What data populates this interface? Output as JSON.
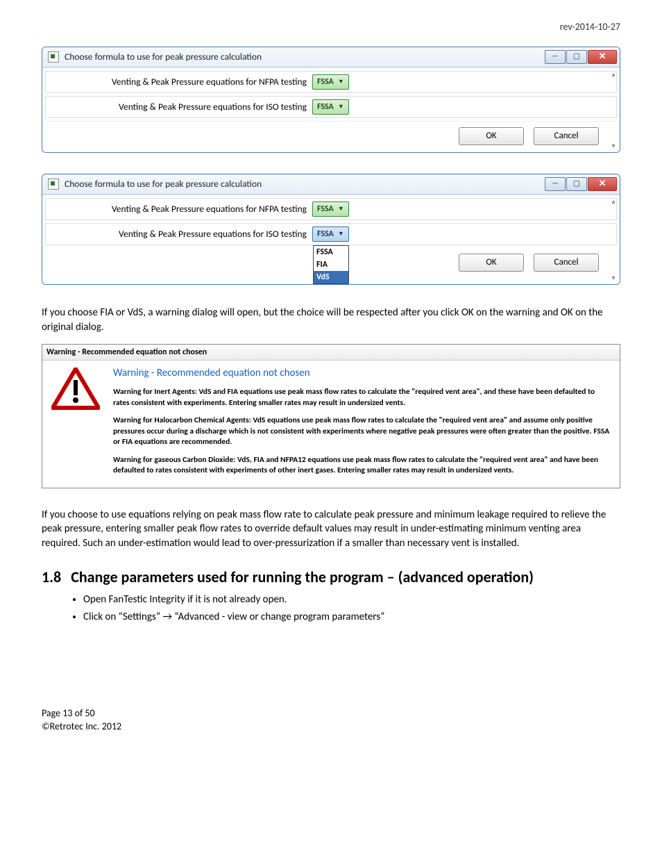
{
  "header": {
    "revision": "rev-2014-10-27"
  },
  "dialog1": {
    "title": "Choose formula to use for peak pressure calculation",
    "row_nfpa_label": "Venting & Peak Pressure equations for NFPA testing",
    "row_nfpa_value": "FSSA",
    "row_iso_label": "Venting & Peak Pressure equations for ISO testing",
    "row_iso_value": "FSSA",
    "ok": "OK",
    "cancel": "Cancel"
  },
  "dialog2": {
    "title": "Choose formula to use for peak pressure calculation",
    "row_nfpa_label": "Venting & Peak Pressure equations for NFPA testing",
    "row_nfpa_value": "FSSA",
    "row_iso_label": "Venting & Peak Pressure equations for ISO testing",
    "row_iso_value": "FSSA",
    "options": {
      "a": "FSSA",
      "b": "FIA",
      "c": "VdS"
    },
    "ok": "OK",
    "cancel": "Cancel"
  },
  "para1": "If you choose FIA or VdS, a warning dialog will open, but the choice will be respected after you click OK on the warning and OK on the original dialog.",
  "warn": {
    "title": "Warning - Recommended equation not chosen",
    "headline": "Warning - Recommended equation not chosen",
    "msg1": "Warning for Inert Agents:  VdS and FIA equations use peak mass flow rates to calculate the \"required vent area\", and these have been defaulted to rates consistent with experiments.  Entering smaller rates may result in undersized vents.",
    "msg2": "Warning for Halocarbon Chemical Agents:  VdS equations use peak mass flow rates to calculate the \"required vent area\" and assume only positive pressures occur during a discharge which is not consistent with experiments where negative peak pressures were often greater than the positive.  FSSA or FIA equations are recommended.",
    "msg3": "Warning for gaseous Carbon Dioxide:  VdS, FIA and NFPA12 equations use peak mass flow rates to calculate the \"required vent area\" and have been defaulted to rates consistent with experiments of other inert gases.  Entering smaller rates may result in undersized vents."
  },
  "para2": "If you choose to use equations relying on peak mass flow rate to calculate peak pressure and minimum leakage required to relieve the peak pressure, entering smaller peak flow rates to override default values may result in under-estimating minimum venting area required. Such an under-estimation would lead to over-pressurization if a smaller than necessary vent is installed.",
  "section": {
    "num": "1.8",
    "title": "Change parameters used for running the program – (advanced operation)",
    "step1": "Open FanTestic Integrity if it is not already open.",
    "step2_a": "Click on “Settings” ",
    "step2_b": " “Advanced - view or change program parameters”"
  },
  "footer": {
    "page": "Page 13 of 50",
    "copyright": "©Retrotec Inc. 2012"
  }
}
